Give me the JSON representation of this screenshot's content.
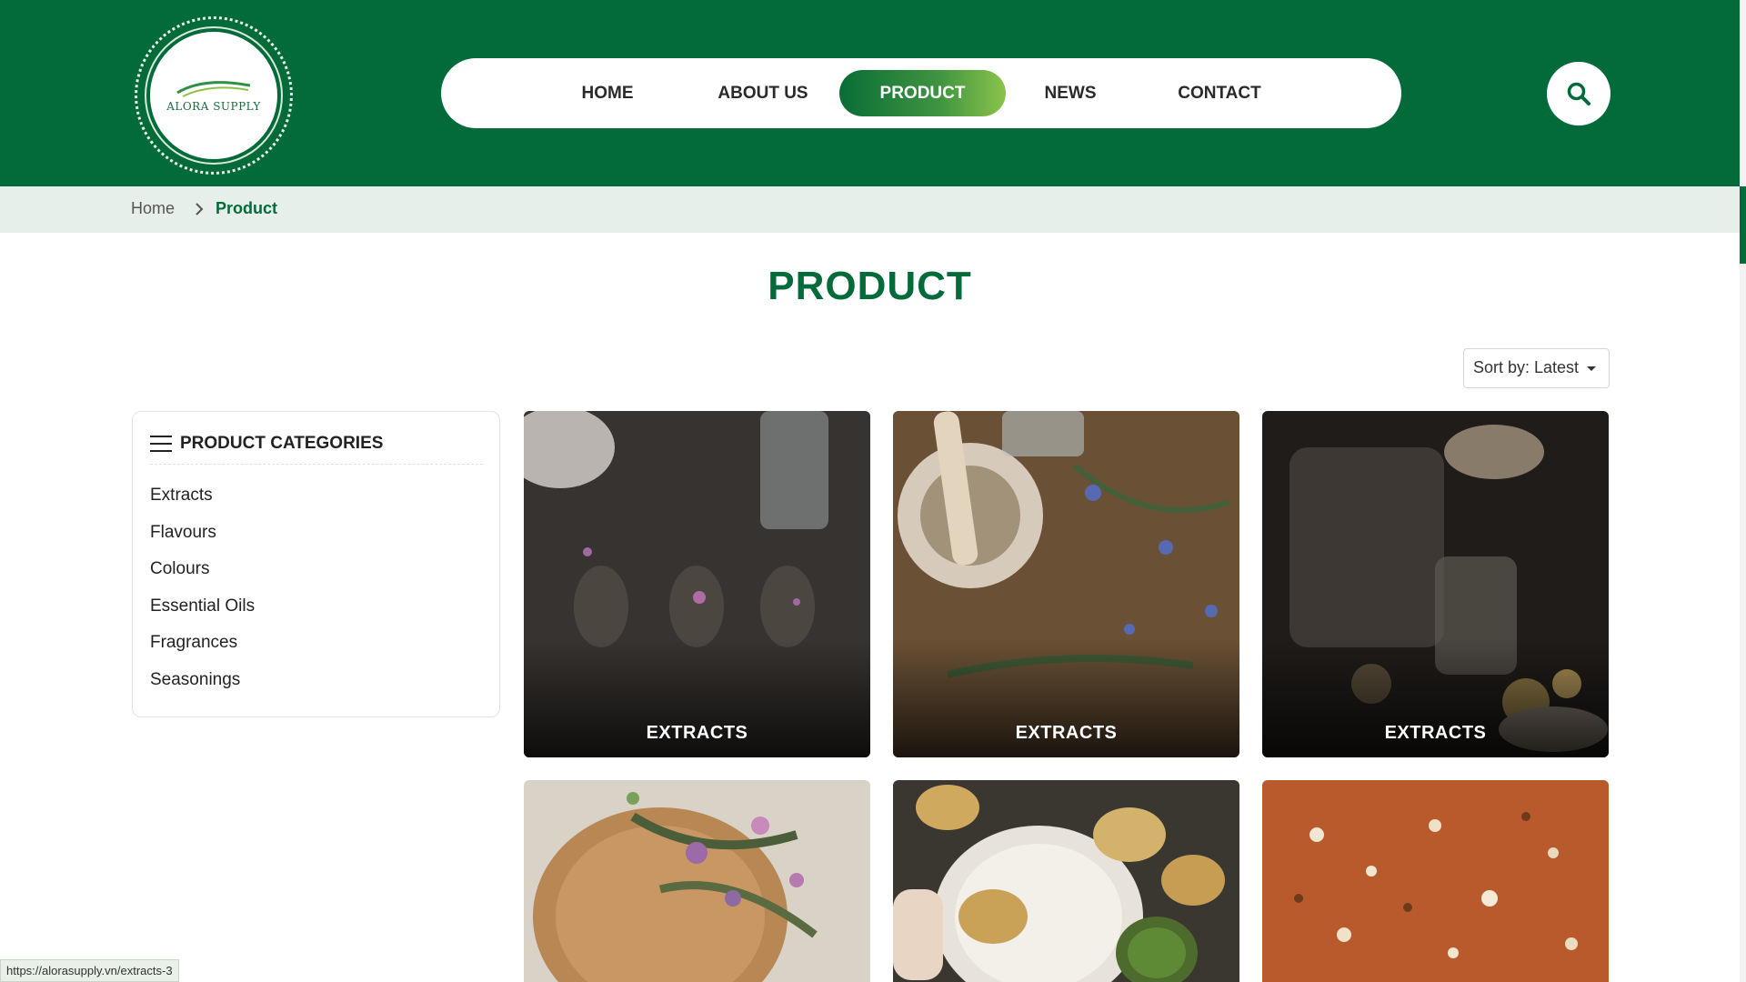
{
  "header": {
    "logo_text": "ALORA SUPPLY",
    "nav": [
      {
        "label": "HOME",
        "active": false
      },
      {
        "label": "ABOUT US",
        "active": false
      },
      {
        "label": "PRODUCT",
        "active": true
      },
      {
        "label": "NEWS",
        "active": false
      },
      {
        "label": "CONTACT",
        "active": false
      }
    ],
    "search_icon": "search-icon"
  },
  "breadcrumb": {
    "home": "Home",
    "current": "Product"
  },
  "page": {
    "title": "PRODUCT",
    "sort_label": "Sort by: Latest"
  },
  "sidebar": {
    "title": "PRODUCT CATEGORIES",
    "items": [
      "Extracts",
      "Flavours",
      "Colours",
      "Essential Oils",
      "Fragrances",
      "Seasonings"
    ]
  },
  "products": [
    {
      "label": "EXTRACTS"
    },
    {
      "label": "EXTRACTS"
    },
    {
      "label": "EXTRACTS"
    },
    {
      "label": ""
    },
    {
      "label": ""
    },
    {
      "label": ""
    }
  ],
  "status_url": "https://alorasupply.vn/extracts-3",
  "colors": {
    "brand_green": "#036b39",
    "breadcrumb_bg": "#e6efe9"
  }
}
